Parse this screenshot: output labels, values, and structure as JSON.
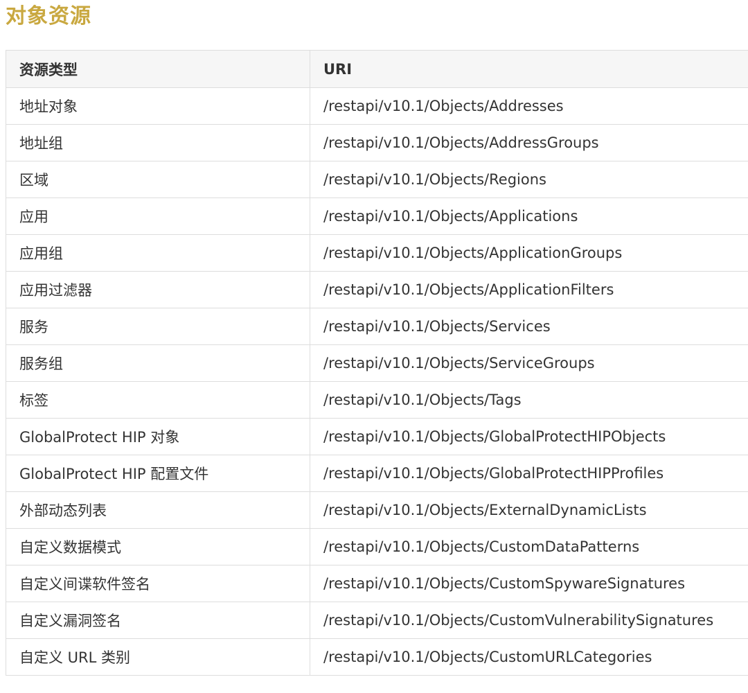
{
  "title": "对象资源",
  "table": {
    "headers": [
      "资源类型",
      "URI"
    ],
    "rows": [
      [
        "地址对象",
        "/restapi/v10.1/Objects/Addresses"
      ],
      [
        "地址组",
        "/restapi/v10.1/Objects/AddressGroups"
      ],
      [
        "区域",
        "/restapi/v10.1/Objects/Regions"
      ],
      [
        "应用",
        "/restapi/v10.1/Objects/Applications"
      ],
      [
        "应用组",
        "/restapi/v10.1/Objects/ApplicationGroups"
      ],
      [
        "应用过滤器",
        "/restapi/v10.1/Objects/ApplicationFilters"
      ],
      [
        "服务",
        "/restapi/v10.1/Objects/Services"
      ],
      [
        "服务组",
        "/restapi/v10.1/Objects/ServiceGroups"
      ],
      [
        "标签",
        "/restapi/v10.1/Objects/Tags"
      ],
      [
        "GlobalProtect HIP 对象",
        "/restapi/v10.1/Objects/GlobalProtectHIPObjects"
      ],
      [
        "GlobalProtect HIP 配置文件",
        "/restapi/v10.1/Objects/GlobalProtectHIPProfiles"
      ],
      [
        "外部动态列表",
        "/restapi/v10.1/Objects/ExternalDynamicLists"
      ],
      [
        "自定义数据模式",
        "/restapi/v10.1/Objects/CustomDataPatterns"
      ],
      [
        "自定义间谍软件签名",
        "/restapi/v10.1/Objects/CustomSpywareSignatures"
      ],
      [
        "自定义漏洞签名",
        "/restapi/v10.1/Objects/CustomVulnerabilitySignatures"
      ],
      [
        "自定义 URL 类别",
        "/restapi/v10.1/Objects/CustomURLCategories"
      ]
    ]
  }
}
